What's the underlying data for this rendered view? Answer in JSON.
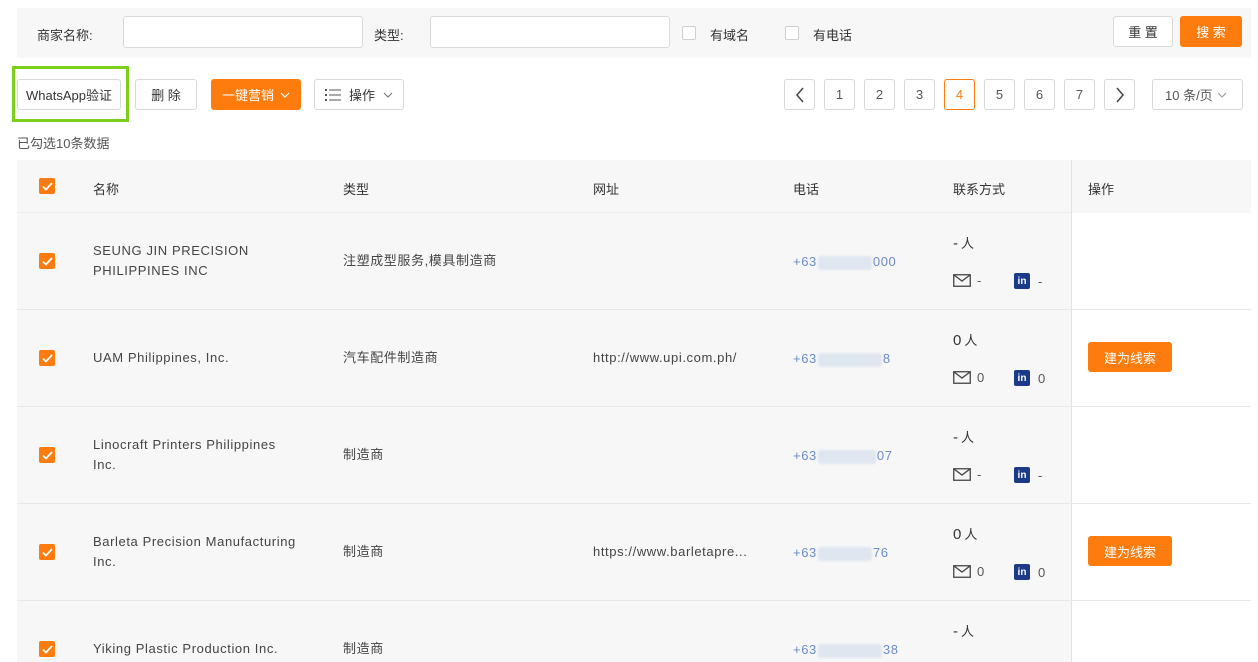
{
  "search": {
    "merchant_label": "商家名称:",
    "merchant_value": "",
    "type_label": "类型:",
    "type_value": "",
    "has_domain_label": "有域名",
    "has_phone_label": "有电话",
    "reset_label": "重 置",
    "search_label": "搜 索"
  },
  "toolbar": {
    "whatsapp_label": "WhatsApp验证",
    "delete_label": "删 除",
    "marketing_label": "一键营销",
    "operate_label": "操作",
    "selected_info": "已勾选10条数据"
  },
  "pagination": {
    "pages": [
      "1",
      "2",
      "3",
      "4",
      "5",
      "6",
      "7"
    ],
    "current": "4",
    "page_size": "10 条/页"
  },
  "table": {
    "headers": [
      "名称",
      "类型",
      "网址",
      "电话",
      "联系方式",
      "操作"
    ],
    "lead_button_label": "建为线索",
    "person_unit": "人",
    "rows": [
      {
        "name": "SEUNG JIN PRECISION PHILIPPINES INC",
        "type": "注塑成型服务,模具制造商",
        "website": "",
        "phone_prefix": "+63",
        "phone_suffix": "000",
        "people": "-",
        "email": "-",
        "linkedin": "-",
        "has_lead_button": false
      },
      {
        "name": "UAM Philippines, Inc.",
        "type": "汽车配件制造商",
        "website": "http://www.upi.com.ph/",
        "phone_prefix": "+63",
        "phone_suffix": "8",
        "people": "0",
        "email": "0",
        "linkedin": "0",
        "has_lead_button": true
      },
      {
        "name": "Linocraft Printers Philippines Inc.",
        "type": "制造商",
        "website": "",
        "phone_prefix": "+63",
        "phone_suffix": "07",
        "people": "-",
        "email": "-",
        "linkedin": "-",
        "has_lead_button": false
      },
      {
        "name": "Barleta Precision Manufacturing Inc.",
        "type": "制造商",
        "website": "https://www.barletapre...",
        "phone_prefix": "+63",
        "phone_suffix": "76",
        "people": "0",
        "email": "0",
        "linkedin": "0",
        "has_lead_button": true
      },
      {
        "name": "Yiking Plastic Production Inc.",
        "type": "制造商",
        "website": "",
        "phone_prefix": "+63",
        "phone_suffix": "38",
        "people": "-",
        "email": "-",
        "linkedin": "-",
        "has_lead_button": false
      }
    ]
  },
  "colors": {
    "accent": "#fe7b0e",
    "highlight": "#7ccf1a",
    "phone": "#6b8cc7",
    "linkedin": "#1b3a8a"
  }
}
